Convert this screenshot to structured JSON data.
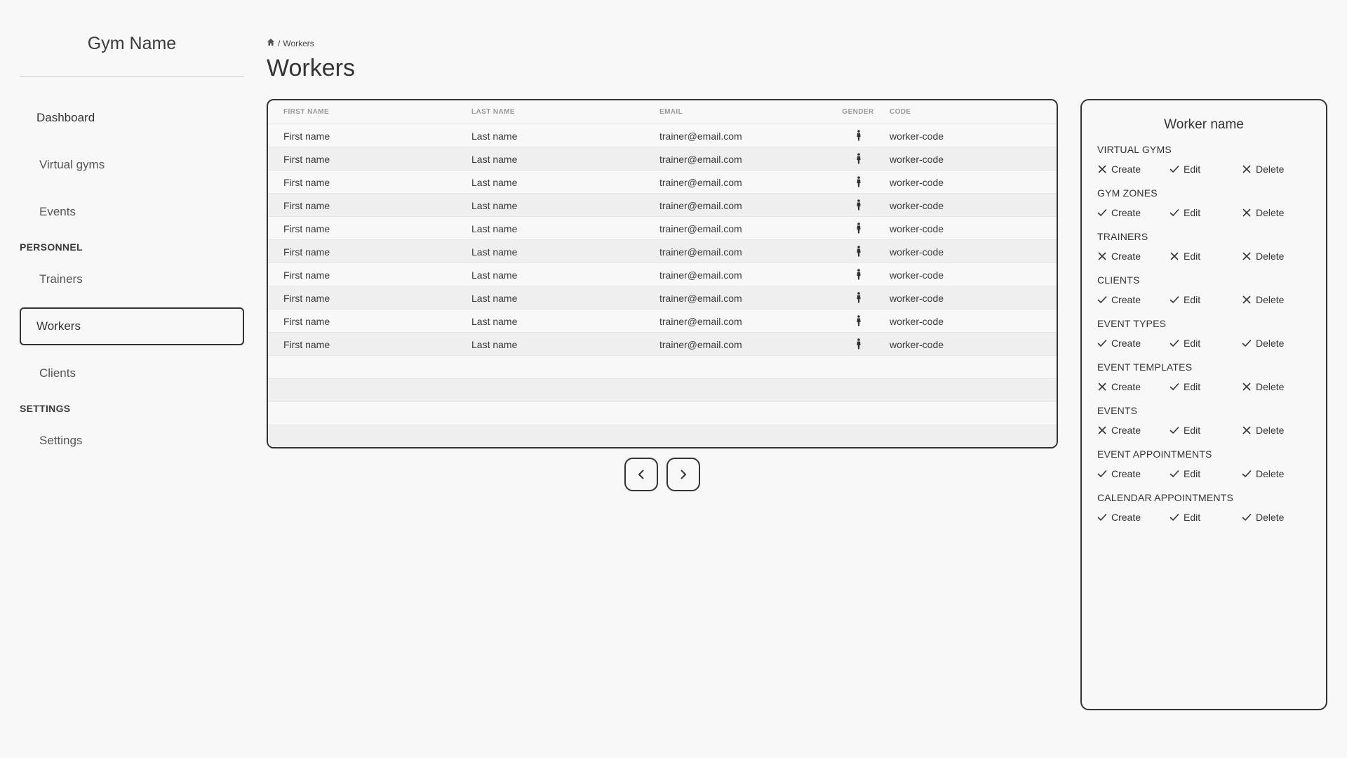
{
  "app": {
    "brand": "Gym Name"
  },
  "sidebar": {
    "items": [
      {
        "label": "Dashboard"
      },
      {
        "label": "Virtual gyms"
      },
      {
        "label": "Events"
      },
      {
        "label": "Trainers"
      },
      {
        "label": "Workers"
      },
      {
        "label": "Clients"
      },
      {
        "label": "Settings"
      }
    ],
    "sections": {
      "personnel": "PERSONNEL",
      "settings": "SETTINGS"
    },
    "active": "Workers"
  },
  "breadcrumb": {
    "current": "Workers",
    "separator": "/"
  },
  "page": {
    "title": "Workers"
  },
  "table": {
    "headers": {
      "first": "FIRST NAME",
      "last": "LAST NAME",
      "email": "EMAIL",
      "gender": "GENDER",
      "code": "CODE"
    },
    "rows": [
      {
        "first": "First name",
        "last": "Last name",
        "email": "trainer@email.com",
        "gender": "person-icon",
        "code": "worker-code"
      },
      {
        "first": "First name",
        "last": "Last name",
        "email": "trainer@email.com",
        "gender": "person-icon",
        "code": "worker-code"
      },
      {
        "first": "First name",
        "last": "Last name",
        "email": "trainer@email.com",
        "gender": "person-icon",
        "code": "worker-code"
      },
      {
        "first": "First name",
        "last": "Last name",
        "email": "trainer@email.com",
        "gender": "person-icon",
        "code": "worker-code"
      },
      {
        "first": "First name",
        "last": "Last name",
        "email": "trainer@email.com",
        "gender": "person-icon",
        "code": "worker-code"
      },
      {
        "first": "First name",
        "last": "Last name",
        "email": "trainer@email.com",
        "gender": "person-icon",
        "code": "worker-code"
      },
      {
        "first": "First name",
        "last": "Last name",
        "email": "trainer@email.com",
        "gender": "person-icon",
        "code": "worker-code"
      },
      {
        "first": "First name",
        "last": "Last name",
        "email": "trainer@email.com",
        "gender": "person-icon",
        "code": "worker-code"
      },
      {
        "first": "First name",
        "last": "Last name",
        "email": "trainer@email.com",
        "gender": "person-icon",
        "code": "worker-code"
      },
      {
        "first": "First name",
        "last": "Last name",
        "email": "trainer@email.com",
        "gender": "person-icon",
        "code": "worker-code"
      }
    ]
  },
  "pagination": {
    "prev_icon": "chevron-left-icon",
    "next_icon": "chevron-right-icon"
  },
  "panel": {
    "title": "Worker name",
    "groups": [
      {
        "label": "VIRTUAL GYMS",
        "perms": [
          {
            "label": "Create",
            "granted": false
          },
          {
            "label": "Edit",
            "granted": true
          },
          {
            "label": "Delete",
            "granted": false
          }
        ]
      },
      {
        "label": "GYM ZONES",
        "perms": [
          {
            "label": "Create",
            "granted": true
          },
          {
            "label": "Edit",
            "granted": true
          },
          {
            "label": "Delete",
            "granted": false
          }
        ]
      },
      {
        "label": "TRAINERS",
        "perms": [
          {
            "label": "Create",
            "granted": false
          },
          {
            "label": "Edit",
            "granted": false
          },
          {
            "label": "Delete",
            "granted": false
          }
        ]
      },
      {
        "label": "CLIENTS",
        "perms": [
          {
            "label": "Create",
            "granted": true
          },
          {
            "label": "Edit",
            "granted": true
          },
          {
            "label": "Delete",
            "granted": false
          }
        ]
      },
      {
        "label": "EVENT TYPES",
        "perms": [
          {
            "label": "Create",
            "granted": true
          },
          {
            "label": "Edit",
            "granted": true
          },
          {
            "label": "Delete",
            "granted": true
          }
        ]
      },
      {
        "label": "EVENT TEMPLATES",
        "perms": [
          {
            "label": "Create",
            "granted": false
          },
          {
            "label": "Edit",
            "granted": true
          },
          {
            "label": "Delete",
            "granted": false
          }
        ]
      },
      {
        "label": "EVENTS",
        "perms": [
          {
            "label": "Create",
            "granted": false
          },
          {
            "label": "Edit",
            "granted": true
          },
          {
            "label": "Delete",
            "granted": false
          }
        ]
      },
      {
        "label": "EVENT APPOINTMENTS",
        "perms": [
          {
            "label": "Create",
            "granted": true
          },
          {
            "label": "Edit",
            "granted": true
          },
          {
            "label": "Delete",
            "granted": true
          }
        ]
      },
      {
        "label": "CALENDAR APPOINTMENTS",
        "perms": [
          {
            "label": "Create",
            "granted": true
          },
          {
            "label": "Edit",
            "granted": true
          },
          {
            "label": "Delete",
            "granted": true
          }
        ]
      }
    ]
  }
}
